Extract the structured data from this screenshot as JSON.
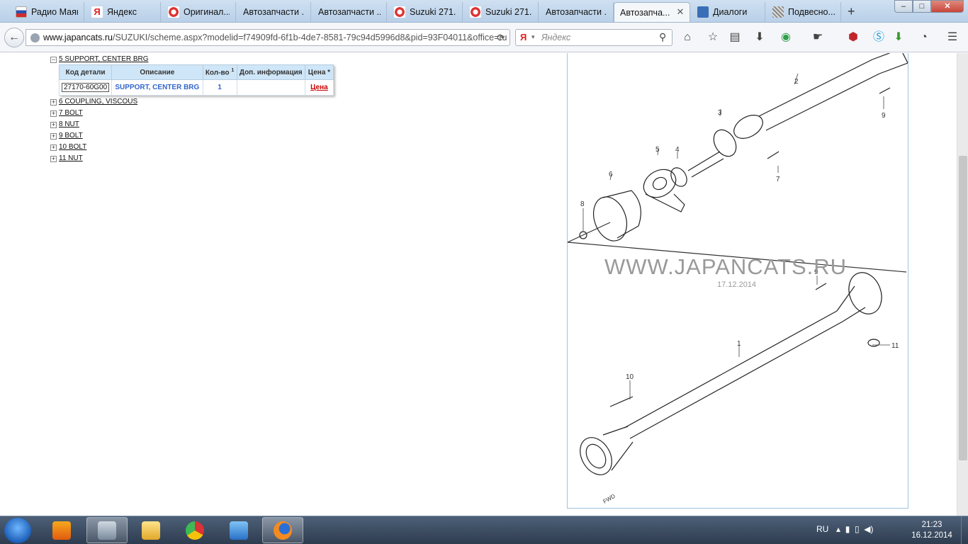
{
  "tabs": [
    {
      "label": "Радио Маяк",
      "icon": "flag-icon"
    },
    {
      "label": "Яндекс",
      "icon": "yandex-icon"
    },
    {
      "label": "Оригинал...",
      "icon": "japancats-icon"
    },
    {
      "label": "Автозапчасти ...",
      "icon": ""
    },
    {
      "label": "Автозапчасти ...",
      "icon": ""
    },
    {
      "label": "Suzuki 271...",
      "icon": "japancats-icon"
    },
    {
      "label": "Suzuki 271...",
      "icon": "japancats-icon"
    },
    {
      "label": "Автозапчасти ...",
      "icon": ""
    },
    {
      "label": "Автозапча...",
      "icon": ""
    },
    {
      "label": "Диалоги",
      "icon": "dialog-icon"
    },
    {
      "label": "Подвесно...",
      "icon": "spring-icon"
    }
  ],
  "window": {
    "min": "–",
    "max": "□",
    "close": "✕"
  },
  "nav": {
    "url_host": "www.japancats.ru",
    "url_path": "/SUZUKI/scheme.aspx?modelid=f74909fd-6f1b-4de7-8581-79c94d5996d8&pid=93F04011&office=ru",
    "search_placeholder": "Яндекс"
  },
  "tree": {
    "expanded": {
      "toggle": "−",
      "label": "5 SUPPORT, CENTER BRG"
    },
    "items": [
      {
        "toggle": "+",
        "label": "6 COUPLING, VISCOUS"
      },
      {
        "toggle": "+",
        "label": "7 BOLT"
      },
      {
        "toggle": "+",
        "label": "8 NUT"
      },
      {
        "toggle": "+",
        "label": "9 BOLT"
      },
      {
        "toggle": "+",
        "label": "10 BOLT"
      },
      {
        "toggle": "+",
        "label": "11 NUT"
      }
    ]
  },
  "parts_table": {
    "headers": [
      "Код детали",
      "Описание",
      "Кол-во",
      "Доп. информация",
      "Цена *"
    ],
    "qty_sup": "1",
    "rows": [
      {
        "code": "27170-60G00",
        "description": "SUPPORT, CENTER BRG",
        "qty": "1",
        "info": "",
        "price": "Цена"
      }
    ]
  },
  "diagram": {
    "watermark": "WWW.JAPANCATS.RU",
    "date": "17.12.2014",
    "callouts": [
      "1",
      "2",
      "3",
      "4",
      "5",
      "6",
      "7",
      "8",
      "9",
      "9",
      "10",
      "11"
    ],
    "fwd_label": "FWD"
  },
  "taskbar": {
    "lang": "RU",
    "time": "21:23",
    "date": "16.12.2014"
  }
}
